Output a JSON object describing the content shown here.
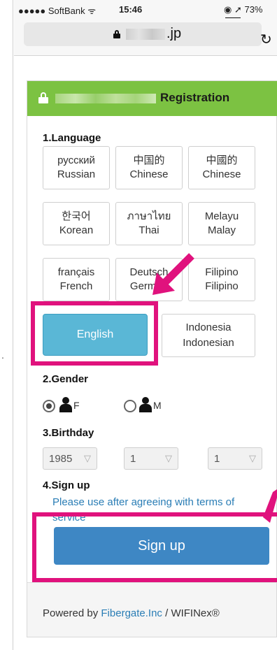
{
  "status_bar": {
    "carrier": "●●●●● SoftBank ᯤ",
    "time": "15:46",
    "battery": "◉ ➚ 73%"
  },
  "browser": {
    "domain_suffix": ".jp",
    "reload_icon": "↻"
  },
  "header": {
    "title": "Registration",
    "bg_color": "#7cc242"
  },
  "sections": {
    "language": "1.Language",
    "gender": "2.Gender",
    "birthday": "3.Birthday",
    "signup": "4.Sign up"
  },
  "languages": [
    {
      "native": "русский",
      "english": "Russian"
    },
    {
      "native": "中国的",
      "english": "Chinese"
    },
    {
      "native": "中國的",
      "english": "Chinese"
    },
    {
      "native": "한국어",
      "english": "Korean"
    },
    {
      "native": "ภาษาไทย",
      "english": "Thai"
    },
    {
      "native": "Melayu",
      "english": "Malay"
    },
    {
      "native": "français",
      "english": "French"
    },
    {
      "native": "Deutsch",
      "english": "German"
    },
    {
      "native": "Filipino",
      "english": "Filipino"
    }
  ],
  "english_button": {
    "label": "English",
    "selected": true,
    "color": "#5ab7d6"
  },
  "indonesian_button": {
    "native": "Indonesia",
    "english": "Indonesian"
  },
  "gender": {
    "female_label": "F",
    "male_label": "M",
    "selected": "F"
  },
  "birthday": {
    "year": "1985",
    "month": "1",
    "day": "1",
    "caret": "▽"
  },
  "signup": {
    "terms_text": "Please use after agreeing with terms of service",
    "button_label": "Sign up",
    "button_color": "#3e87c4"
  },
  "footer": {
    "prefix": "Powered by ",
    "link": "Fibergate.Inc",
    "suffix": " / WIFINex®"
  },
  "annotation_color": "#e0127d",
  "side_mark": "."
}
